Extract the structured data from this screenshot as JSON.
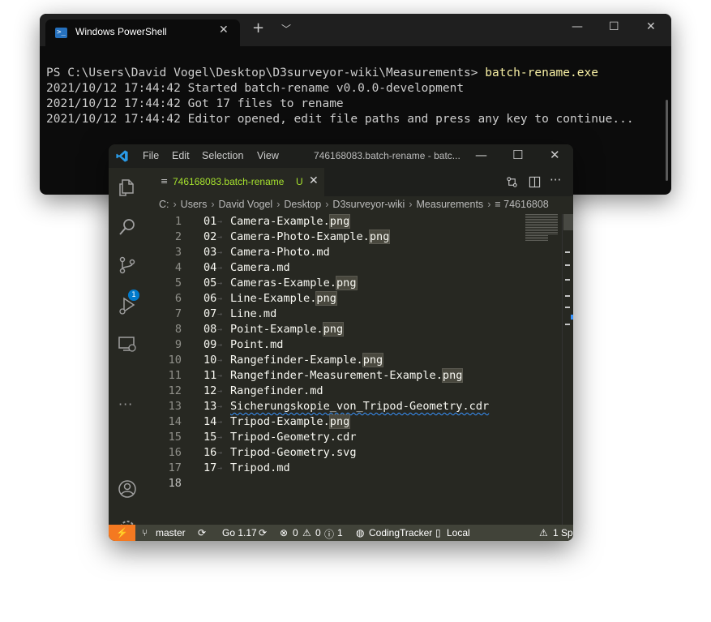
{
  "powershell": {
    "tab_title": "Windows PowerShell",
    "prompt": "PS C:\\Users\\David Vogel\\Desktop\\D3surveyor-wiki\\Measurements>",
    "command": "batch-rename.exe",
    "output": [
      "2021/10/12 17:44:42 Started batch-rename v0.0.0-development",
      "2021/10/12 17:44:42 Got 17 files to rename",
      "2021/10/12 17:44:42 Editor opened, edit file paths and press any key to continue..."
    ]
  },
  "vscode": {
    "menu": [
      "File",
      "Edit",
      "Selection",
      "View"
    ],
    "window_title": "746168083.batch-rename - batc...",
    "tab": {
      "label": "746168083.batch-rename",
      "status": "U"
    },
    "breadcrumb": [
      "C:",
      "Users",
      "David Vogel",
      "Desktop",
      "D3surveyor-wiki",
      "Measurements",
      "74616808"
    ],
    "scm_badge": "1",
    "lines": [
      {
        "n": "1",
        "prefix": "01",
        "name": "Camera-Example.",
        "ext": "png"
      },
      {
        "n": "2",
        "prefix": "02",
        "name": "Camera-Photo-Example.",
        "ext": "png"
      },
      {
        "n": "3",
        "prefix": "03",
        "name": "Camera-Photo.md",
        "ext": ""
      },
      {
        "n": "4",
        "prefix": "04",
        "name": "Camera.md",
        "ext": ""
      },
      {
        "n": "5",
        "prefix": "05",
        "name": "Cameras-Example.",
        "ext": "png"
      },
      {
        "n": "6",
        "prefix": "06",
        "name": "Line-Example.",
        "ext": "png"
      },
      {
        "n": "7",
        "prefix": "07",
        "name": "Line.md",
        "ext": ""
      },
      {
        "n": "8",
        "prefix": "08",
        "name": "Point-Example.",
        "ext": "png"
      },
      {
        "n": "9",
        "prefix": "09",
        "name": "Point.md",
        "ext": ""
      },
      {
        "n": "10",
        "prefix": "10",
        "name": "Rangefinder-Example.",
        "ext": "png"
      },
      {
        "n": "11",
        "prefix": "11",
        "name": "Rangefinder-Measurement-Example.",
        "ext": "png"
      },
      {
        "n": "12",
        "prefix": "12",
        "name": "Rangefinder.md",
        "ext": ""
      },
      {
        "n": "13",
        "prefix": "13",
        "name": "Sicherungskopie_von_Tripod-Geometry.cdr",
        "ext": ""
      },
      {
        "n": "14",
        "prefix": "14",
        "name": "Tripod-Example.",
        "ext": "png"
      },
      {
        "n": "15",
        "prefix": "15",
        "name": "Tripod-Geometry.cdr",
        "ext": ""
      },
      {
        "n": "16",
        "prefix": "16",
        "name": "Tripod-Geometry.svg",
        "ext": ""
      },
      {
        "n": "17",
        "prefix": "17",
        "name": "Tripod.md",
        "ext": ""
      },
      {
        "n": "18",
        "prefix": "",
        "name": "",
        "ext": ""
      }
    ],
    "status": {
      "branch": "master",
      "go_version": "Go 1.17",
      "errors": "0",
      "warnings": "0",
      "info": "1",
      "coding_tracker": "CodingTracker",
      "local": "Local",
      "problems": "1 Sp"
    },
    "colors": {
      "accent_green": "#a6e22e",
      "remote_orange": "#f47921",
      "badge_blue": "#007acc"
    }
  }
}
